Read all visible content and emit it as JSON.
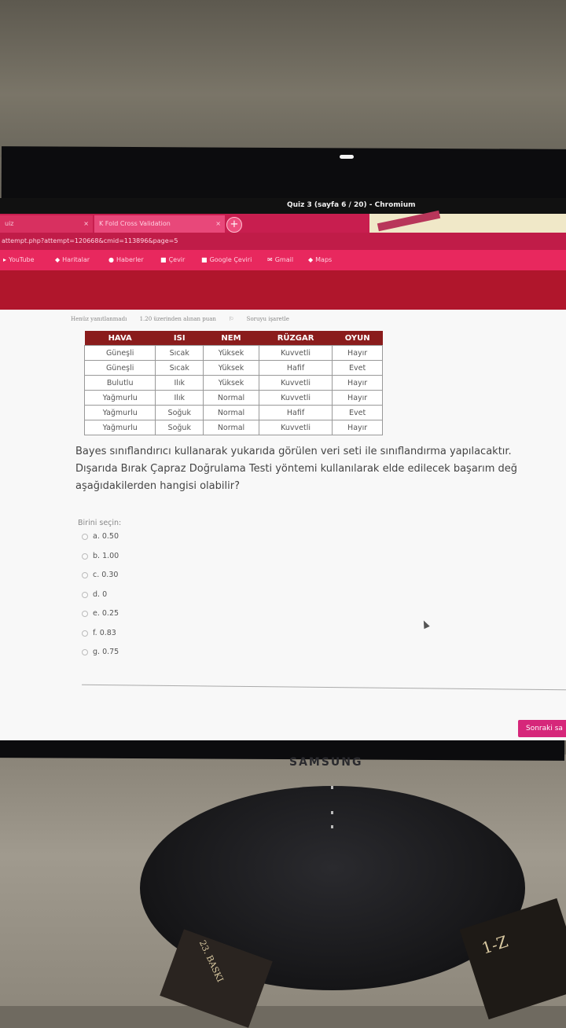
{
  "window": {
    "title": "Quiz 3 (sayfa 6 / 20) - Chromium"
  },
  "tabs": [
    {
      "label": "uiz",
      "close": "×"
    },
    {
      "label": "K Fold Cross Validation",
      "close": "×"
    }
  ],
  "new_tab": "+",
  "url": "attempt.php?attempt=120668&cmid=113896&page=5",
  "bookmarks": [
    "YouTube",
    "Haritalar",
    "Haberler",
    "Çevir",
    "Google Çeviri",
    "Gmail",
    "Maps"
  ],
  "question_info": {
    "status": "Henüz yanıtlanmadı",
    "points": "1.20 üzerinden alınan puan",
    "flag": "Soruyu işaretle"
  },
  "table": {
    "headers": [
      "HAVA",
      "ISI",
      "NEM",
      "RÜZGAR",
      "OYUN"
    ],
    "rows": [
      [
        "Güneşli",
        "Sıcak",
        "Yüksek",
        "Kuvvetli",
        "Hayır"
      ],
      [
        "Güneşli",
        "Sıcak",
        "Yüksek",
        "Hafif",
        "Evet"
      ],
      [
        "Bulutlu",
        "Ilık",
        "Yüksek",
        "Kuvvetli",
        "Hayır"
      ],
      [
        "Yağmurlu",
        "Ilık",
        "Normal",
        "Kuvvetli",
        "Hayır"
      ],
      [
        "Yağmurlu",
        "Soğuk",
        "Normal",
        "Hafif",
        "Evet"
      ],
      [
        "Yağmurlu",
        "Soğuk",
        "Normal",
        "Kuvvetli",
        "Hayır"
      ]
    ]
  },
  "question": {
    "line1": "Bayes sınıflandırıcı kullanarak yukarıda görülen veri seti ile sınıflandırma yapılacaktır.",
    "line2": "Dışarıda Bırak Çapraz Doğrulama Testi yöntemi kullanılarak elde edilecek başarım değ",
    "line3": "aşağıdakilerden hangisi olabilir?"
  },
  "choose_label": "Birini seçin:",
  "options": [
    "a. 0.50",
    "b. 1.00",
    "c. 0.30",
    "d. 0",
    "e. 0.25",
    "f. 0.83",
    "g. 0.75"
  ],
  "next_button": "Sonraki sa",
  "monitor_brand": "SAMSUNG",
  "book_labels": {
    "right": "1-Z",
    "left": "23. BASKI"
  }
}
